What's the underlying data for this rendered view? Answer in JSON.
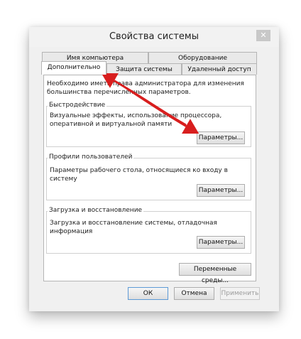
{
  "window": {
    "title": "Свойства системы",
    "close_glyph": "✕"
  },
  "tabs": {
    "row1": [
      "Имя компьютера",
      "Оборудование"
    ],
    "row2": [
      "Дополнительно",
      "Защита системы",
      "Удаленный доступ"
    ],
    "active": "Дополнительно"
  },
  "panel": {
    "intro": "Необходимо иметь права администратора для изменения большинства перечисленных параметров.",
    "performance": {
      "label": "Быстродействие",
      "description": "Визуальные эффекты, использование процессора, оперативной и виртуальной памяти",
      "button": "Параметры..."
    },
    "profiles": {
      "label": "Профили пользователей",
      "description": "Параметры рабочего стола, относящиеся ко входу в систему",
      "button": "Параметры..."
    },
    "startup": {
      "label": "Загрузка и восстановление",
      "description": "Загрузка и восстановление системы, отладочная информация",
      "button": "Параметры..."
    },
    "env_button": "Переменные среды..."
  },
  "footer": {
    "ok": "ОК",
    "cancel": "Отмена",
    "apply": "Применить"
  },
  "colors": {
    "arrow": "#d81e1e",
    "window_bg": "#f0f0f0"
  }
}
